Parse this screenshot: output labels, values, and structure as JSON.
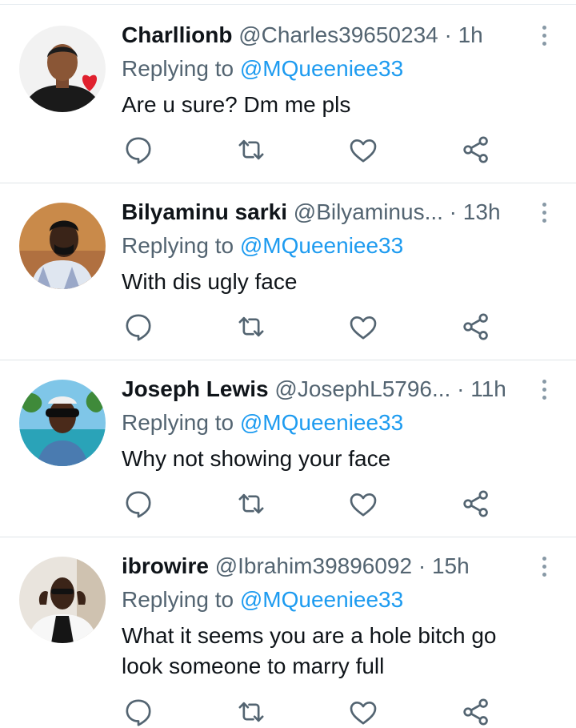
{
  "replies": [
    {
      "name": "Charllionb",
      "handle": "@Charles39650234",
      "sep": " · ",
      "time": "1h",
      "replying_prefix": "Replying to ",
      "replying_to": "@MQueeniee33",
      "text": "Are u sure? Dm me pls"
    },
    {
      "name": "Bilyaminu sarki",
      "handle": "@Bilyaminus...",
      "sep": " · ",
      "time": "13h",
      "replying_prefix": "Replying to ",
      "replying_to": "@MQueeniee33",
      "text": "With dis ugly face"
    },
    {
      "name": "Joseph Lewis",
      "handle": "@JosephL5796...",
      "sep": " · ",
      "time": "11h",
      "replying_prefix": "Replying to ",
      "replying_to": "@MQueeniee33",
      "text": "Why not showing your face"
    },
    {
      "name": "ibrowire",
      "handle": "@Ibrahim39896092",
      "sep": " · ",
      "time": "15h",
      "replying_prefix": "Replying to ",
      "replying_to": "@MQueeniee33",
      "text": "What it seems you are a hole bitch go look someone to marry full"
    }
  ],
  "icons": {
    "reply": "reply-icon",
    "retweet": "retweet-icon",
    "like": "heart-icon",
    "share": "share-icon",
    "more": "more-options-icon"
  },
  "colors": {
    "link": "#1d9bf0",
    "secondary_text": "#536471",
    "icon": "#536471",
    "divider": "#dfe4e8"
  }
}
